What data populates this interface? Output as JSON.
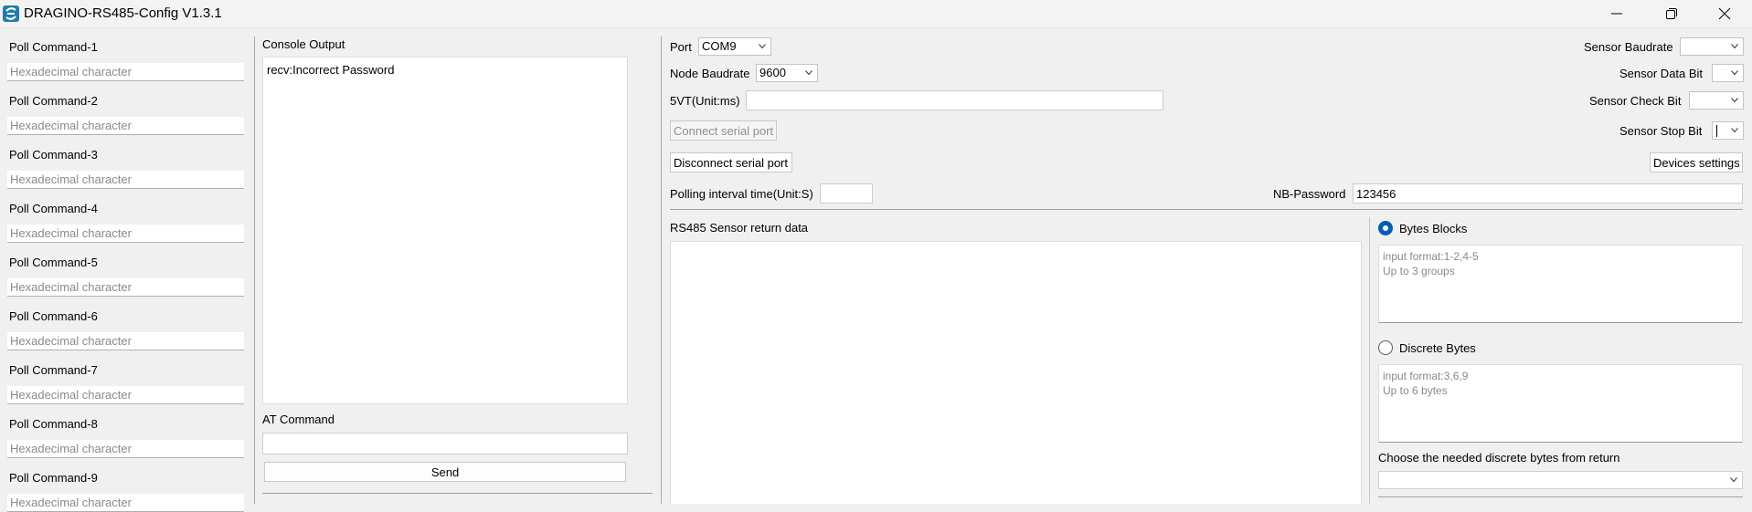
{
  "window": {
    "title": "DRAGINO-RS485-Config V1.3.1"
  },
  "poll_commands": [
    {
      "label": "Poll Command-1",
      "placeholder": "Hexadecimal character"
    },
    {
      "label": "Poll Command-2",
      "placeholder": "Hexadecimal character"
    },
    {
      "label": "Poll Command-3",
      "placeholder": "Hexadecimal character"
    },
    {
      "label": "Poll Command-4",
      "placeholder": "Hexadecimal character"
    },
    {
      "label": "Poll Command-5",
      "placeholder": "Hexadecimal character"
    },
    {
      "label": "Poll Command-6",
      "placeholder": "Hexadecimal character"
    },
    {
      "label": "Poll Command-7",
      "placeholder": "Hexadecimal character"
    },
    {
      "label": "Poll Command-8",
      "placeholder": "Hexadecimal character"
    },
    {
      "label": "Poll Command-9",
      "placeholder": "Hexadecimal character"
    }
  ],
  "console": {
    "title": "Console Output",
    "text": "recv:Incorrect Password",
    "at_label": "AT Command",
    "at_value": "",
    "send_label": "Send"
  },
  "config": {
    "port_label": "Port",
    "port_value": "COM9",
    "node_baud_label": "Node Baudrate",
    "node_baud_value": "9600",
    "fivevt_label": "5VT(Unit:ms)",
    "fivevt_value": "",
    "connect_label": "Connect serial port",
    "disconnect_label": "Disconnect serial port",
    "polling_label": "Polling interval time(Unit:S)",
    "polling_value": "",
    "nb_password_label": "NB-Password",
    "nb_password_value": "123456",
    "sensor_baud_label": "Sensor Baudrate",
    "sensor_data_bit_label": "Sensor Data Bit",
    "sensor_check_bit_label": "Sensor Check Bit",
    "sensor_stop_bit_label": "Sensor Stop Bit",
    "devices_settings_label": "Devices settings"
  },
  "rs485": {
    "title": "RS485 Sensor return data",
    "text": ""
  },
  "bytes": {
    "blocks_label": "Bytes Blocks",
    "blocks_selected": true,
    "blocks_hint": "input format:1-2,4-5\nUp to 3 groups",
    "discrete_label": "Discrete Bytes",
    "discrete_selected": false,
    "discrete_hint": "input format:3,6,9\nUp to 6 bytes",
    "choose_label": "Choose the needed discrete bytes from return"
  },
  "icons": {
    "app": "dragino-logo-icon",
    "minimize": "minimize-icon",
    "restore": "restore-icon",
    "close": "close-icon",
    "chevron": "chevron-down-icon"
  },
  "colors": {
    "accent": "#005fb8",
    "logo": "#1e7fa8",
    "background": "#f0f0f0"
  }
}
